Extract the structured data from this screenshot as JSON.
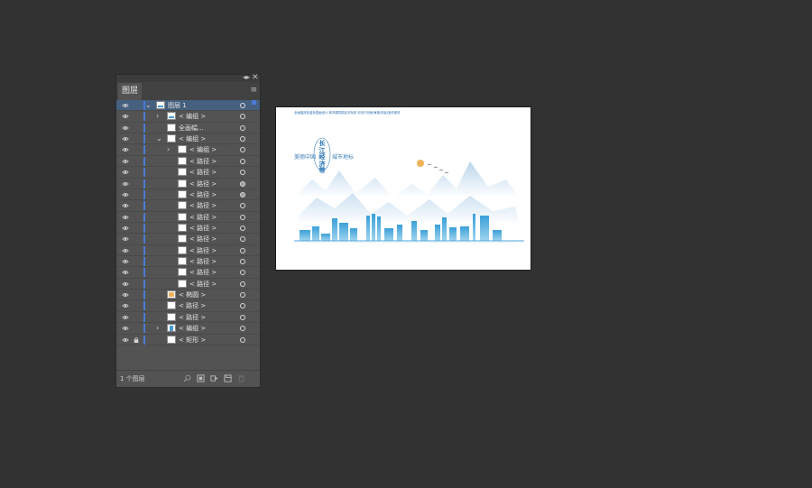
{
  "panel": {
    "tab_label": "图层",
    "layer_count": "1 个图层",
    "accent_color": "#4b7bd6",
    "selected_color": "#46607f"
  },
  "layers": [
    {
      "label": "图层 1",
      "indent": 0,
      "disclosure": "open",
      "thumb": "layer",
      "selected": true,
      "locked": false,
      "target": "ring"
    },
    {
      "label": "< 编组 >",
      "indent": 1,
      "disclosure": "closed",
      "thumb": "group",
      "locked": false,
      "target": "ring"
    },
    {
      "label": "全画幅...",
      "indent": 1,
      "disclosure": "",
      "thumb": "blank",
      "locked": false,
      "target": "ring"
    },
    {
      "label": "< 编组 >",
      "indent": 1,
      "disclosure": "open",
      "thumb": "blank",
      "locked": false,
      "target": "ring"
    },
    {
      "label": "< 编组 >",
      "indent": 2,
      "disclosure": "closed",
      "thumb": "blank",
      "locked": false,
      "target": "ring"
    },
    {
      "label": "< 路径 >",
      "indent": 2,
      "disclosure": "",
      "thumb": "blank",
      "locked": false,
      "target": "ring"
    },
    {
      "label": "< 路径 >",
      "indent": 2,
      "disclosure": "",
      "thumb": "blank",
      "locked": false,
      "target": "ring"
    },
    {
      "label": "< 路径 >",
      "indent": 2,
      "disclosure": "",
      "thumb": "blank",
      "locked": false,
      "target": "filled"
    },
    {
      "label": "< 路径 >",
      "indent": 2,
      "disclosure": "",
      "thumb": "blank",
      "locked": false,
      "target": "filled"
    },
    {
      "label": "< 路径 >",
      "indent": 2,
      "disclosure": "",
      "thumb": "blank",
      "locked": false,
      "target": "ring"
    },
    {
      "label": "< 路径 >",
      "indent": 2,
      "disclosure": "",
      "thumb": "blank",
      "locked": false,
      "target": "ring"
    },
    {
      "label": "< 路径 >",
      "indent": 2,
      "disclosure": "",
      "thumb": "blank",
      "locked": false,
      "target": "ring"
    },
    {
      "label": "< 路径 >",
      "indent": 2,
      "disclosure": "",
      "thumb": "blank",
      "locked": false,
      "target": "ring"
    },
    {
      "label": "< 路径 >",
      "indent": 2,
      "disclosure": "",
      "thumb": "blank",
      "locked": false,
      "target": "ring"
    },
    {
      "label": "< 路径 >",
      "indent": 2,
      "disclosure": "",
      "thumb": "blank",
      "locked": false,
      "target": "ring"
    },
    {
      "label": "< 路径 >",
      "indent": 2,
      "disclosure": "",
      "thumb": "blank",
      "locked": false,
      "target": "ring"
    },
    {
      "label": "< 路径 >",
      "indent": 2,
      "disclosure": "",
      "thumb": "blank",
      "locked": false,
      "target": "ring"
    },
    {
      "label": "< 椭圆 >",
      "indent": 1,
      "disclosure": "",
      "thumb": "ellipse",
      "locked": false,
      "target": "ring"
    },
    {
      "label": "< 路径 >",
      "indent": 1,
      "disclosure": "",
      "thumb": "blank",
      "locked": false,
      "target": "ring"
    },
    {
      "label": "< 路径 >",
      "indent": 1,
      "disclosure": "",
      "thumb": "blank",
      "locked": false,
      "target": "ring"
    },
    {
      "label": "< 编组 >",
      "indent": 1,
      "disclosure": "closed",
      "thumb": "group2",
      "locked": false,
      "target": "ring"
    },
    {
      "label": "< 矩形 >",
      "indent": 1,
      "disclosure": "",
      "thumb": "blank",
      "locked": true,
      "target": "ring"
    }
  ],
  "artwork": {
    "top_text": "全画幅双色蓝色插画设计 城市建筑剪影天际线 可用于封面/海报/背景/宣传素材",
    "left_text": "美丽中国",
    "right_text": "城市地标",
    "title": "长江经济带"
  },
  "icons": {
    "visibility": "eye-icon",
    "lock": "lock-icon",
    "footer": [
      "search-icon",
      "make-clipping-mask-icon",
      "new-sublayer-icon",
      "new-layer-icon",
      "trash-icon"
    ]
  }
}
